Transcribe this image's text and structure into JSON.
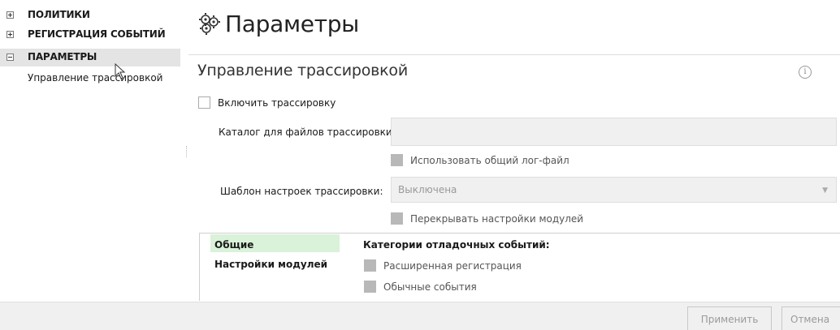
{
  "tree": {
    "items": [
      {
        "label": "ПОЛИТИКИ",
        "expanded": false
      },
      {
        "label": "РЕГИСТРАЦИЯ СОБЫТИЙ",
        "expanded": false
      },
      {
        "label": "ПАРАМЕТРЫ",
        "expanded": true,
        "selected": true
      }
    ],
    "sub_item": "Управление трассировкой"
  },
  "header": {
    "title": "Параметры",
    "icon": "gear-group-icon"
  },
  "section": {
    "title": "Управление трассировкой",
    "info_icon": "info-icon",
    "enable_tracing_label": "Включить трассировку",
    "enable_tracing_checked": false,
    "directory_label": "Каталог для файлов трассировки:",
    "directory_value": "",
    "shared_log_label": "Использовать общий лог-файл",
    "template_label": "Шаблон настроек трассировки:",
    "template_value": "Выключена",
    "override_label": "Перекрывать настройки модулей"
  },
  "inner_nav": {
    "items": [
      "Общие",
      "Настройки модулей"
    ],
    "selected": "Общие",
    "selected_color": "#d9f2d9"
  },
  "categories": {
    "title": "Категории отладочных событий:",
    "items": [
      "Расширенная регистрация",
      "Обычные события"
    ]
  },
  "footer": {
    "apply_label": "Применить",
    "cancel_label": "Отмена"
  }
}
